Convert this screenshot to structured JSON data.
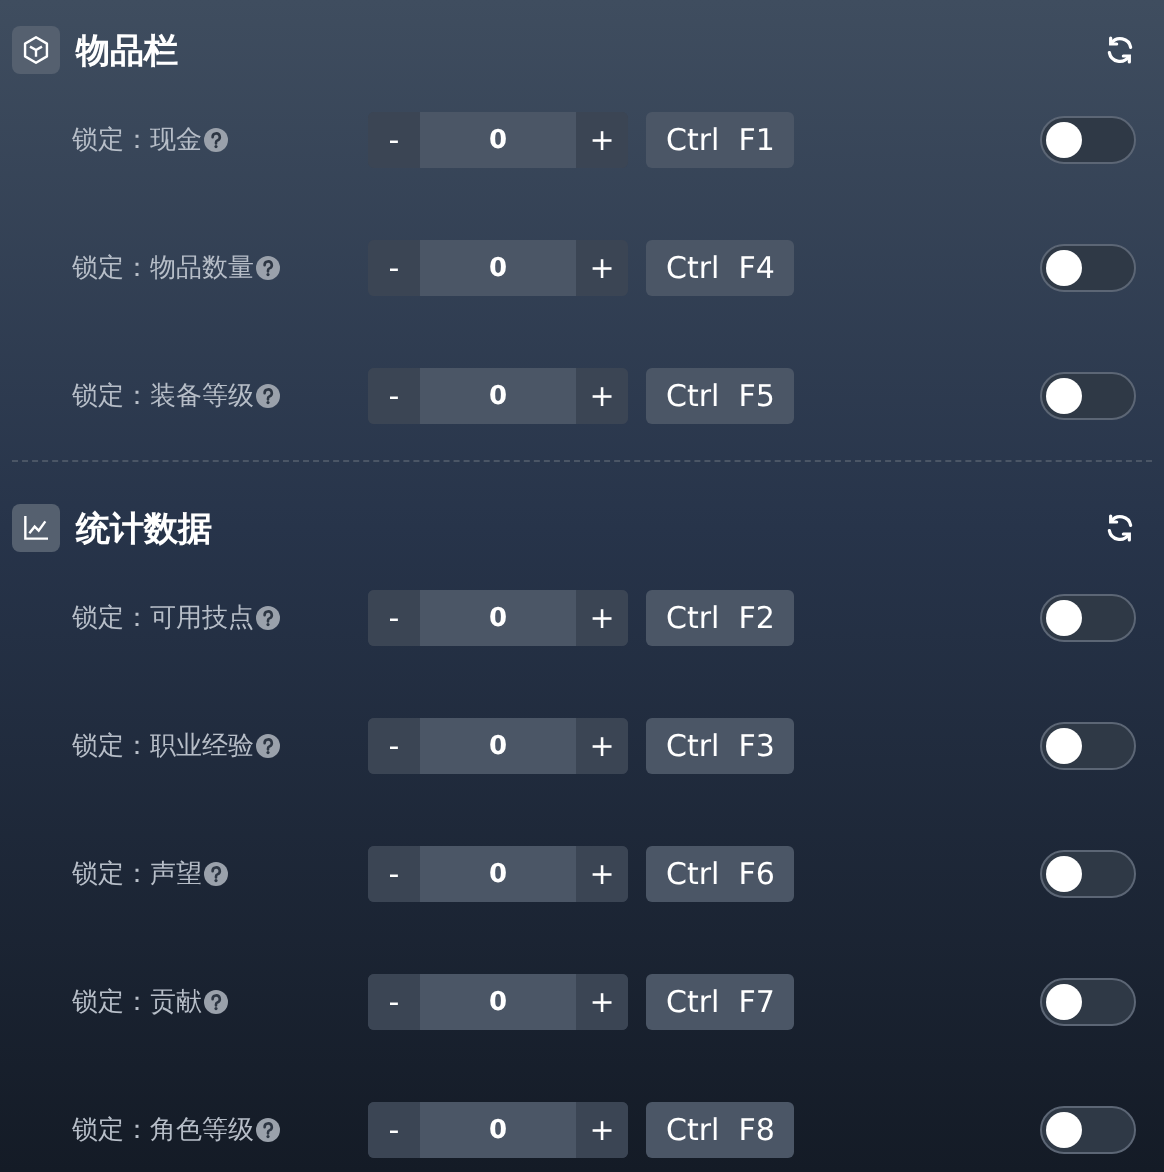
{
  "sections": [
    {
      "kind": "box",
      "title": "物品栏",
      "rows": [
        {
          "label": "锁定：现金",
          "decrement": "-",
          "value": "0",
          "increment": "+",
          "hotkey": "Ctrl  F1",
          "on": false
        },
        {
          "label": "锁定：物品数量",
          "decrement": "-",
          "value": "0",
          "increment": "+",
          "hotkey": "Ctrl  F4",
          "on": false
        },
        {
          "label": "锁定：装备等级",
          "decrement": "-",
          "value": "0",
          "increment": "+",
          "hotkey": "Ctrl  F5",
          "on": false
        }
      ]
    },
    {
      "kind": "chart",
      "title": "统计数据",
      "rows": [
        {
          "label": "锁定：可用技点",
          "decrement": "-",
          "value": "0",
          "increment": "+",
          "hotkey": "Ctrl  F2",
          "on": false
        },
        {
          "label": "锁定：职业经验",
          "decrement": "-",
          "value": "0",
          "increment": "+",
          "hotkey": "Ctrl  F3",
          "on": false
        },
        {
          "label": "锁定：声望",
          "decrement": "-",
          "value": "0",
          "increment": "+",
          "hotkey": "Ctrl  F6",
          "on": false
        },
        {
          "label": "锁定：贡献",
          "decrement": "-",
          "value": "0",
          "increment": "+",
          "hotkey": "Ctrl  F7",
          "on": false
        },
        {
          "label": "锁定：角色等级",
          "decrement": "-",
          "value": "0",
          "increment": "+",
          "hotkey": "Ctrl  F8",
          "on": false
        }
      ]
    }
  ]
}
